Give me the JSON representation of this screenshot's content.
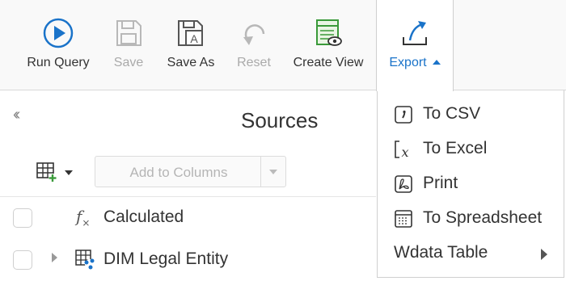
{
  "toolbar": {
    "run_query": "Run Query",
    "save": "Save",
    "save_as": "Save As",
    "reset": "Reset",
    "create_view": "Create View",
    "export": "Export"
  },
  "sidebar": {
    "title": "Sources",
    "add_columns_placeholder": "Add to Columns",
    "items": [
      {
        "label": "Calculated",
        "icon": "function-icon"
      },
      {
        "label": "DIM Legal Entity",
        "icon": "dimension-table-icon"
      }
    ]
  },
  "export_menu": {
    "items": [
      {
        "label": "To CSV",
        "icon": "csv-icon"
      },
      {
        "label": "To Excel",
        "icon": "excel-icon"
      },
      {
        "label": "Print",
        "icon": "print-icon"
      },
      {
        "label": "To Spreadsheet",
        "icon": "spreadsheet-icon"
      },
      {
        "label": "Wdata Table",
        "icon": "chevron-right-icon"
      }
    ]
  },
  "colors": {
    "accent": "#1a73c9",
    "green": "#3a9a3a",
    "disabled": "#aaaaaa"
  }
}
